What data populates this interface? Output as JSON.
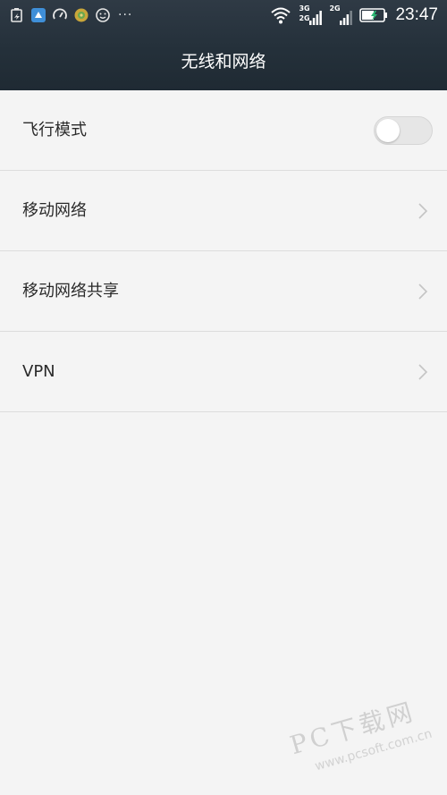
{
  "status_bar": {
    "notification_icons": [
      "battery-saver-icon",
      "app-store-icon",
      "speedometer-icon",
      "game-icon",
      "emoji-icon"
    ],
    "more_indicator": "···",
    "network_labels": [
      "3G",
      "2G",
      "2G"
    ],
    "time": "23:47",
    "battery_state": "charging"
  },
  "header": {
    "title": "无线和网络"
  },
  "settings": {
    "items": [
      {
        "label": "飞行模式",
        "control": "toggle",
        "toggle_on": false
      },
      {
        "label": "移动网络",
        "control": "chevron"
      },
      {
        "label": "移动网络共享",
        "control": "chevron"
      },
      {
        "label": "VPN",
        "control": "chevron"
      }
    ]
  },
  "watermark": {
    "main": "PC下载网",
    "site": "www.pcsoft.com.cn"
  },
  "colors": {
    "header_bg": "#25313b",
    "page_bg": "#f4f4f4",
    "divider": "#dcdcdc",
    "text": "#2a2a2a"
  }
}
